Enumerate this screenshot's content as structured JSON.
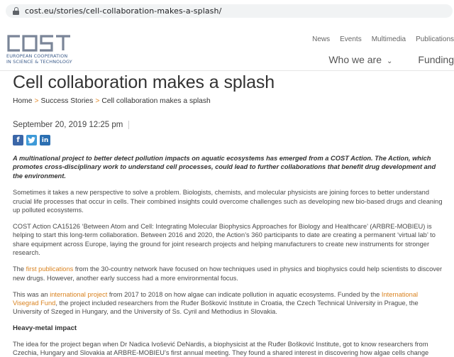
{
  "browser": {
    "url": "cost.eu/stories/cell-collaboration-makes-a-splash/"
  },
  "header": {
    "logo_text": "COST",
    "tagline_line1": "EUROPEAN COOPERATION",
    "tagline_line2": "IN SCIENCE & TECHNOLOGY",
    "topnav": [
      "News",
      "Events",
      "Multimedia",
      "Publications"
    ],
    "mainnav": {
      "who_we_are": "Who we are",
      "funding": "Funding"
    }
  },
  "article": {
    "title": "Cell collaboration makes a splash",
    "breadcrumb": {
      "home": "Home",
      "sep": ">",
      "success": "Success Stories",
      "current": "Cell collaboration makes a splash"
    },
    "date": "September 20, 2019 12:25 pm",
    "social": {
      "facebook": "f",
      "twitter": "t",
      "linkedin": "in"
    },
    "lead": "A multinational project to better detect pollution impacts on aquatic ecosystems has emerged from a COST Action. The Action, which promotes cross-disciplinary work to understand cell processes, could lead to further collaborations that benefit drug development and the environment.",
    "p1": "Sometimes it takes a new perspective to solve a problem. Biologists, chemists, and molecular physicists are joining forces to better understand crucial life processes that occur in cells. Their combined insights could overcome challenges such as developing new bio-based drugs and cleaning up polluted ecosystems.",
    "p2": "COST Action CA15126 ‘Between Atom and Cell: Integrating Molecular Biophysics Approaches for Biology and Healthcare’ (ARBRE-MOBIEU) is helping to start this long-term collaboration. Between 2016 and 2020, the Action’s 360 participants to date are creating a permanent ‘virtual lab’ to share equipment across Europe, laying the ground for joint research projects and helping manufacturers to create new instruments for stronger research.",
    "p3": {
      "pre": "The ",
      "link": "first publications",
      "post": " from the 30-country network have focused on how techniques used in physics and biophysics could help scientists to discover new drugs. However, another early success had a more environmental focus."
    },
    "p4": {
      "pre": "This was an ",
      "link1": "international project",
      "mid": " from 2017 to 2018 on how algae can indicate pollution in aquatic ecosystems. Funded by the ",
      "link2": "International Visegrad Fund",
      "post": ", the project included researchers from the Ruđer Bošković Institute in Croatia, the Czech Technical University in Prague, the University of Szeged in Hungary, and the University of Ss. Cyril and Methodius in Slovakia."
    },
    "subheading": "Heavy-metal impact",
    "p5": "The idea for the project began when Dr Nadica Ivošević DeNardis, a biophysicist at the Ruđer Bošković Institute, got to know researchers from Czechia, Hungary and Slovakia at ARBRE-MOBIEU’s first annual meeting. They found a shared interest in discovering how algae cells change when heavy metals are present in aquatic systems."
  },
  "colors": {
    "accent": "#d9821f",
    "logo": "#3b5b8a",
    "facebook": "#3a66a8",
    "twitter": "#3e9ad8",
    "linkedin": "#2b6fb2"
  }
}
